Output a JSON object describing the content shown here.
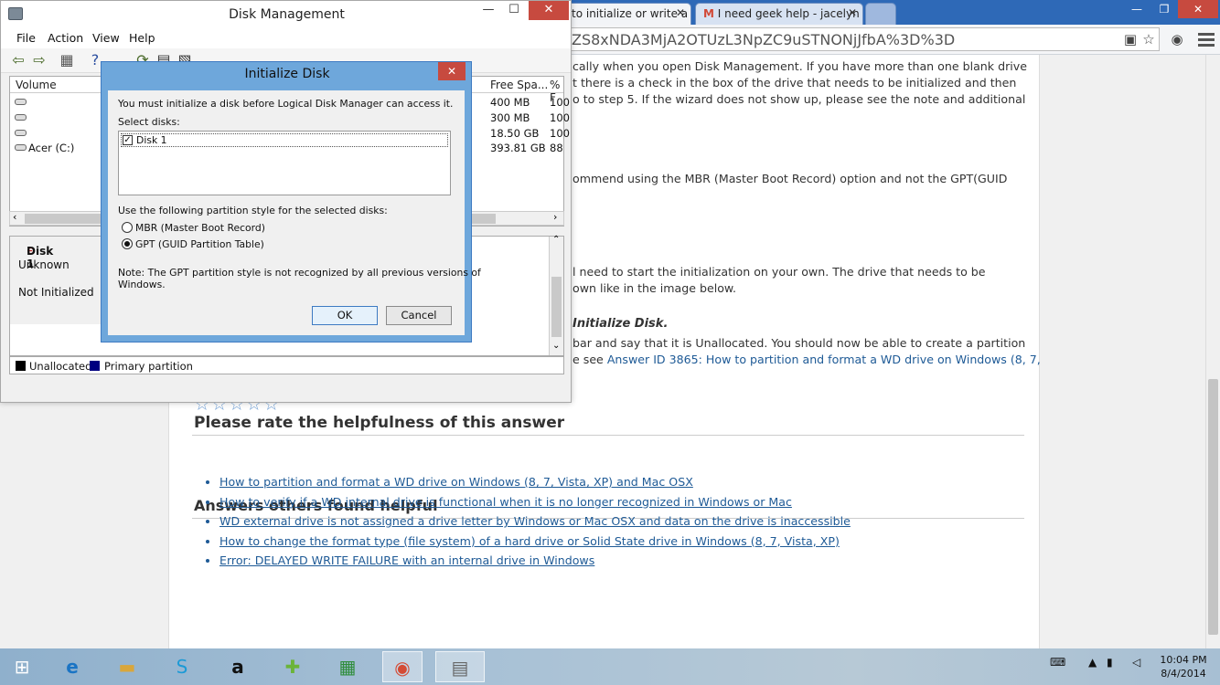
{
  "browser": {
    "tabs": [
      {
        "label": "to initialize or write a"
      },
      {
        "label": "I need geek help - jacelyn"
      }
    ],
    "url": "ZS8xNDA3MjA2OTUzL3NpZC9uSTNONjJfbA%3D%3D"
  },
  "article": {
    "para1": [
      "cally when you open Disk Management. If you have more than one blank drive",
      "t there is a check in the box of the drive that needs to be initialized and then",
      "o to step 5. If the wizard does not show up, please see the note and additional"
    ],
    "para2": "ommend using the MBR (Master Boot Record) option and not the GPT(GUID",
    "para3": [
      "l need to start the initialization on your own. The drive that needs to be",
      "own like in the image below."
    ],
    "step_heading": "Initialize Disk.",
    "para4_line1": "bar and say that it is Unallocated. You should now be able to create a partition",
    "para4_prefix": "e see ",
    "para4_link": "Answer ID 3865: How to partition and format a WD drive on Windows (8, 7,",
    "rate_heading": "Please rate the helpfulness of this answer",
    "stars": "☆☆☆☆☆",
    "others_heading": "Answers others found helpful",
    "helpful_links": [
      "How to partition and format a WD drive on Windows (8, 7, Vista, XP) and Mac OSX",
      "How to verify if a WD internal drive is functional when it is no longer recognized in Windows or Mac",
      "WD external drive is not assigned a drive letter by Windows or Mac OSX and data on the drive is inaccessible",
      "How to change the format type (file system) of a hard drive or Solid State drive in Windows (8, 7, Vista, XP)",
      "Error: DELAYED WRITE FAILURE with an internal drive in Windows"
    ]
  },
  "disk_mgmt": {
    "title": "Disk Management",
    "menu": [
      "File",
      "Action",
      "View",
      "Help"
    ],
    "columns": {
      "volume": "Volume",
      "free_space": "Free Spa...",
      "percent": "% F"
    },
    "volumes": [
      {
        "name": "",
        "free": "400 MB",
        "pct": "100"
      },
      {
        "name": "",
        "free": "300 MB",
        "pct": "100"
      },
      {
        "name": "",
        "free": "18.50 GB",
        "pct": "100"
      },
      {
        "name": "Acer (C:)",
        "free": "393.81 GB",
        "pct": "88"
      }
    ],
    "disk": {
      "name": "Disk 1",
      "type": "Unknown",
      "status": "Not Initialized"
    },
    "legend": {
      "unallocated": "Unallocated",
      "primary": "Primary partition"
    },
    "colors": {
      "unallocated": "#000000",
      "primary": "#000080"
    }
  },
  "dialog": {
    "title": "Initialize Disk",
    "intro": "You must initialize a disk before Logical Disk Manager can access it.",
    "select_label": "Select disks:",
    "disk_item": "Disk 1",
    "style_label": "Use the following partition style for the selected disks:",
    "mbr": "MBR (Master Boot Record)",
    "gpt": "GPT (GUID Partition Table)",
    "note_line1": "Note: The GPT partition style is not recognized by all previous versions of",
    "note_line2": "Windows.",
    "ok": "OK",
    "cancel": "Cancel"
  },
  "taskbar": {
    "time": "10:04 PM",
    "date": "8/4/2014"
  }
}
